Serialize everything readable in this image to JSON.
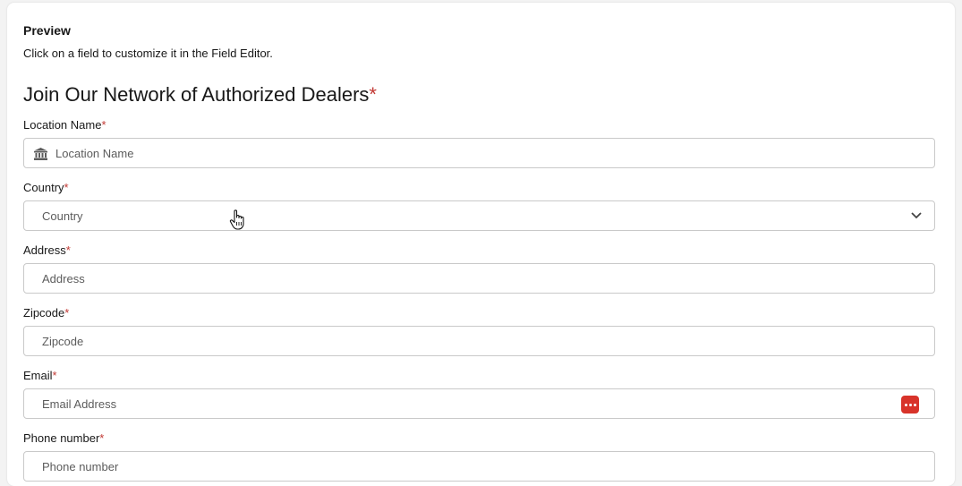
{
  "preview": {
    "title": "Preview",
    "description": "Click on a field to customize it in the Field Editor."
  },
  "form": {
    "title": "Join Our Network of Authorized Dealers",
    "required_mark": "*",
    "fields": {
      "location": {
        "label": "Location Name",
        "placeholder": "Location Name",
        "icon": "bank-icon"
      },
      "country": {
        "label": "Country",
        "placeholder": "Country",
        "icon": "chevron-down-icon"
      },
      "address": {
        "label": "Address",
        "placeholder": "Address"
      },
      "zipcode": {
        "label": "Zipcode",
        "placeholder": "Zipcode"
      },
      "email": {
        "label": "Email",
        "placeholder": "Email Address",
        "icon": "password-manager-icon"
      },
      "phone": {
        "label": "Phone number",
        "placeholder": "Phone number"
      }
    }
  },
  "colors": {
    "required": "#c23934",
    "border": "#c9c9c9",
    "password_manager": "#d8332a"
  }
}
